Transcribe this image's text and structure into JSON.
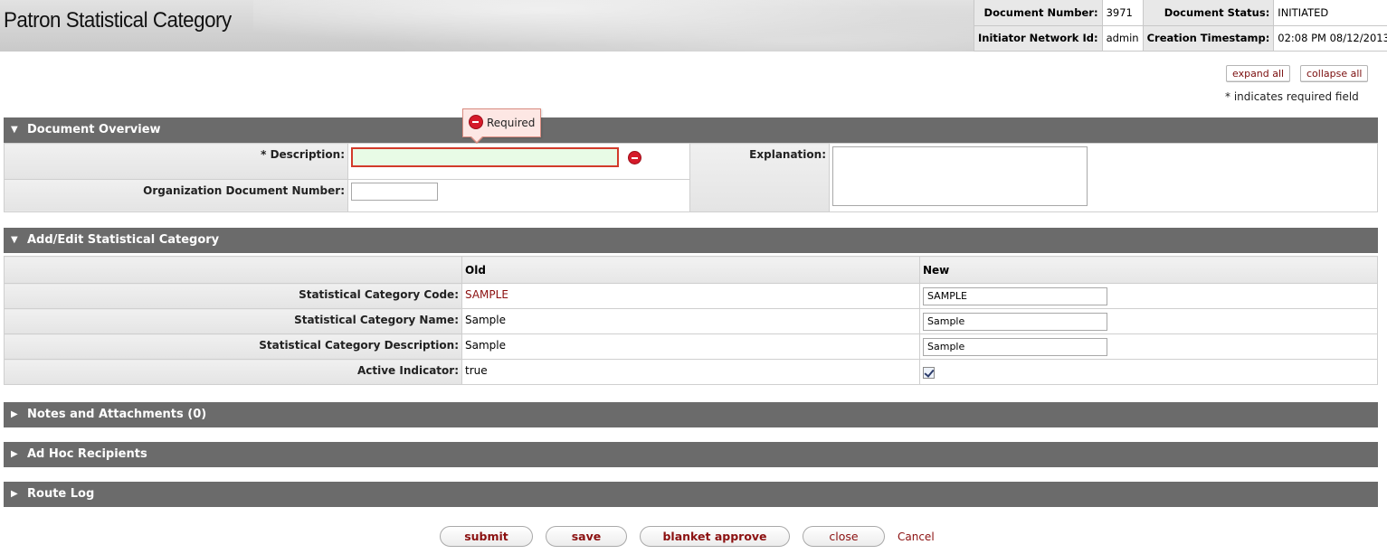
{
  "header": {
    "title": "Patron Statistical Category",
    "doc_number_label": "Document Number:",
    "doc_number": "3971",
    "doc_status_label": "Document Status:",
    "doc_status": "INITIATED",
    "initiator_label": "Initiator Network Id:",
    "initiator": "admin",
    "timestamp_label": "Creation Timestamp:",
    "timestamp": "02:08 PM 08/12/2013"
  },
  "controls": {
    "expand_all": "expand all",
    "collapse_all": "collapse all",
    "required_note": "* indicates required field"
  },
  "sections": {
    "overview": "Document Overview",
    "add_edit": "Add/Edit Statistical Category",
    "notes": "Notes and Attachments (0)",
    "adhoc": "Ad Hoc Recipients",
    "route_log": "Route Log"
  },
  "overview": {
    "description_label": "* Description:",
    "description_value": "",
    "org_doc_label": "Organization Document Number:",
    "org_doc_value": "",
    "explanation_label": "Explanation:",
    "explanation_value": "",
    "tooltip": "Required"
  },
  "add_edit": {
    "col_old": "Old",
    "col_new": "New",
    "rows": [
      {
        "label": "Statistical Category Code:",
        "old": "SAMPLE",
        "new": "SAMPLE"
      },
      {
        "label": "Statistical Category Name:",
        "old": "Sample",
        "new": "Sample"
      },
      {
        "label": "Statistical Category Description:",
        "old": "Sample",
        "new": "Sample"
      },
      {
        "label": "Active Indicator:",
        "old": "true",
        "new_checked": true
      }
    ]
  },
  "buttons": {
    "submit": "submit",
    "save": "save",
    "blanket_approve": "blanket approve",
    "close": "close",
    "cancel": "Cancel"
  },
  "colors": {
    "section_bar": "#6b6b6b",
    "accent_text": "#8b1010",
    "error_red": "#d51a2a",
    "required_fill": "#e8fbe6"
  }
}
